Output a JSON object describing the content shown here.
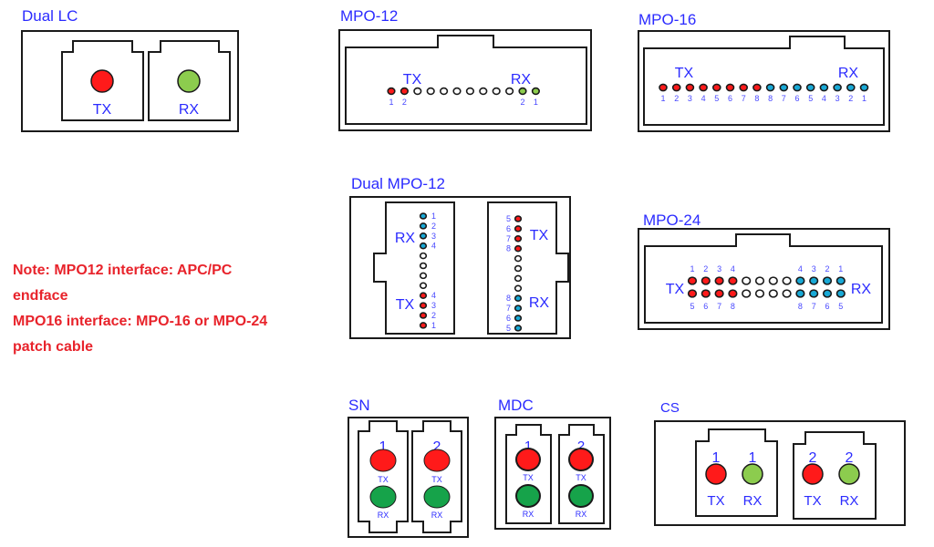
{
  "colors": {
    "label_blue": "#2b2bff",
    "number_blue": "#4a4aff",
    "tx_red": "#ff1a1a",
    "rx_light_green": "#8ccc4e",
    "rx_green": "#16a34a",
    "rx_cyan": "#19a9d6",
    "empty_fiber": "#ffffff",
    "outline": "#1a1a1a",
    "note_red": "#e8232b"
  },
  "note": {
    "lines": [
      "Note: MPO12 interface: APC/PC",
      "endface",
      "MPO16 interface: MPO-16 or MPO-24",
      "patch cable"
    ]
  },
  "connectors": {
    "dual_lc": {
      "title": "Dual LC",
      "ports": [
        {
          "label": "TX",
          "color": "tx_red"
        },
        {
          "label": "RX",
          "color": "rx_light_green"
        }
      ]
    },
    "mpo12": {
      "title": "MPO-12",
      "tx_label": "TX",
      "rx_label": "RX",
      "fibers": [
        "tx",
        "tx",
        "empty",
        "empty",
        "empty",
        "empty",
        "empty",
        "empty",
        "empty",
        "empty",
        "rx",
        "rx"
      ],
      "numbers": [
        "1",
        "2",
        "",
        "",
        "",
        "",
        "",
        "",
        "",
        "",
        "2",
        "1"
      ]
    },
    "mpo16": {
      "title": "MPO-16",
      "tx_label": "TX",
      "rx_label": "RX",
      "fibers": [
        "tx",
        "tx",
        "tx",
        "tx",
        "tx",
        "tx",
        "tx",
        "tx",
        "rx",
        "rx",
        "rx",
        "rx",
        "rx",
        "rx",
        "rx",
        "rx"
      ],
      "numbers": [
        "1",
        "2",
        "3",
        "4",
        "5",
        "6",
        "7",
        "8",
        "8",
        "7",
        "6",
        "5",
        "4",
        "3",
        "2",
        "1"
      ]
    },
    "dual_mpo12": {
      "title": "Dual MPO-12",
      "left": {
        "rx_label": "RX",
        "tx_label": "TX",
        "fibers": [
          "rx",
          "rx",
          "rx",
          "rx",
          "empty",
          "empty",
          "empty",
          "empty",
          "tx",
          "tx",
          "tx",
          "tx"
        ],
        "numbers": [
          "1",
          "2",
          "3",
          "4",
          "",
          "",
          "",
          "",
          "4",
          "3",
          "2",
          "1"
        ]
      },
      "right": {
        "tx_label": "TX",
        "rx_label": "RX",
        "fibers": [
          "tx",
          "tx",
          "tx",
          "tx",
          "empty",
          "empty",
          "empty",
          "empty",
          "rx",
          "rx",
          "rx",
          "rx"
        ],
        "numbers": [
          "5",
          "6",
          "7",
          "8",
          "",
          "",
          "",
          "",
          "8",
          "7",
          "6",
          "5"
        ]
      }
    },
    "mpo24": {
      "title": "MPO-24",
      "tx_label": "TX",
      "rx_label": "RX",
      "top_row": [
        "tx",
        "tx",
        "tx",
        "tx",
        "empty",
        "empty",
        "empty",
        "empty",
        "rx",
        "rx",
        "rx",
        "rx"
      ],
      "bottom_row": [
        "tx",
        "tx",
        "tx",
        "tx",
        "empty",
        "empty",
        "empty",
        "empty",
        "rx",
        "rx",
        "rx",
        "rx"
      ],
      "top_numbers": [
        "1",
        "2",
        "3",
        "4",
        "",
        "",
        "",
        "",
        "4",
        "3",
        "2",
        "1"
      ],
      "bottom_numbers": [
        "5",
        "6",
        "7",
        "8",
        "",
        "",
        "",
        "",
        "8",
        "7",
        "6",
        "5"
      ]
    },
    "sn": {
      "title": "SN",
      "ports": [
        {
          "number": "1",
          "tx_label": "TX",
          "rx_label": "RX"
        },
        {
          "number": "2",
          "tx_label": "TX",
          "rx_label": "RX"
        }
      ]
    },
    "mdc": {
      "title": "MDC",
      "ports": [
        {
          "number": "1",
          "tx_label": "TX",
          "rx_label": "RX"
        },
        {
          "number": "2",
          "tx_label": "TX",
          "rx_label": "RX"
        }
      ]
    },
    "cs": {
      "title": "CS",
      "ports": [
        {
          "tx_number": "1",
          "rx_number": "1",
          "tx_label": "TX",
          "rx_label": "RX"
        },
        {
          "tx_number": "2",
          "rx_number": "2",
          "tx_label": "TX",
          "rx_label": "RX"
        }
      ]
    }
  }
}
